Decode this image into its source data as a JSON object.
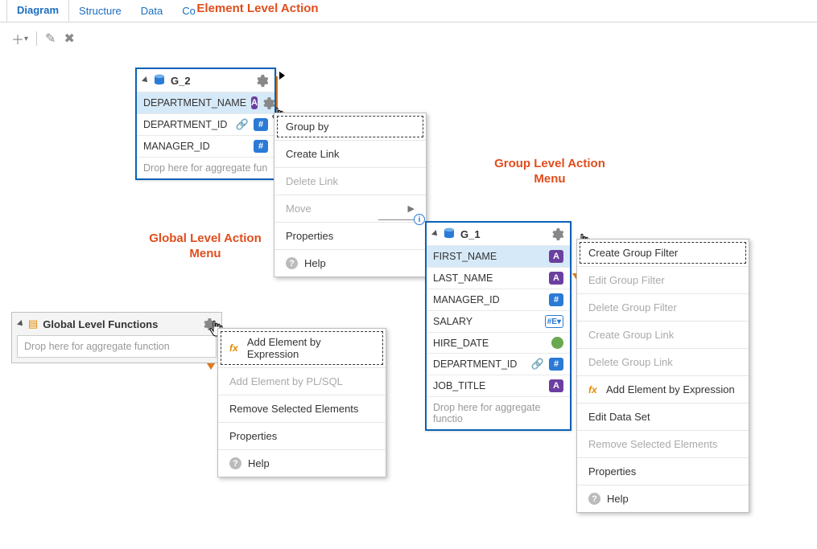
{
  "annotations": {
    "element_level": "Element Level Action",
    "global_level_l1": "Global Level Action",
    "global_level_l2": "Menu",
    "group_level_l1": "Group Level Action",
    "group_level_l2": "Menu"
  },
  "tabs": {
    "diagram": "Diagram",
    "structure": "Structure",
    "data": "Data",
    "code": "Co"
  },
  "group_g2": {
    "title": "G_2",
    "rows": {
      "department_name": "DEPARTMENT_NAME",
      "department_id": "DEPARTMENT_ID",
      "manager_id": "MANAGER_ID"
    },
    "drop": "Drop here for aggregate fun"
  },
  "group_g1": {
    "title": "G_1",
    "rows": {
      "first_name": "FIRST_NAME",
      "last_name": "LAST_NAME",
      "manager_id": "MANAGER_ID",
      "salary": "SALARY",
      "hire_date": "HIRE_DATE",
      "department_id": "DEPARTMENT_ID",
      "job_title": "JOB_TITLE"
    },
    "drop": "Drop here for aggregate functio"
  },
  "element_menu": {
    "group_by": "Group by",
    "create_link": "Create Link",
    "delete_link": "Delete Link",
    "move": "Move",
    "properties": "Properties",
    "help": "Help"
  },
  "global_panel": {
    "title": "Global Level Functions",
    "drop": "Drop here for aggregate function"
  },
  "global_menu": {
    "add_expr": "Add Element by Expression",
    "add_plsql": "Add Element by PL/SQL",
    "remove": "Remove Selected Elements",
    "properties": "Properties",
    "help": "Help"
  },
  "group_menu": {
    "create_filter": "Create Group Filter",
    "edit_filter": "Edit Group Filter",
    "delete_filter": "Delete Group Filter",
    "create_link": "Create Group Link",
    "delete_link": "Delete Group Link",
    "add_expr": "Add Element by Expression",
    "edit_data_set": "Edit Data Set",
    "remove": "Remove Selected Elements",
    "properties": "Properties",
    "help": "Help"
  }
}
